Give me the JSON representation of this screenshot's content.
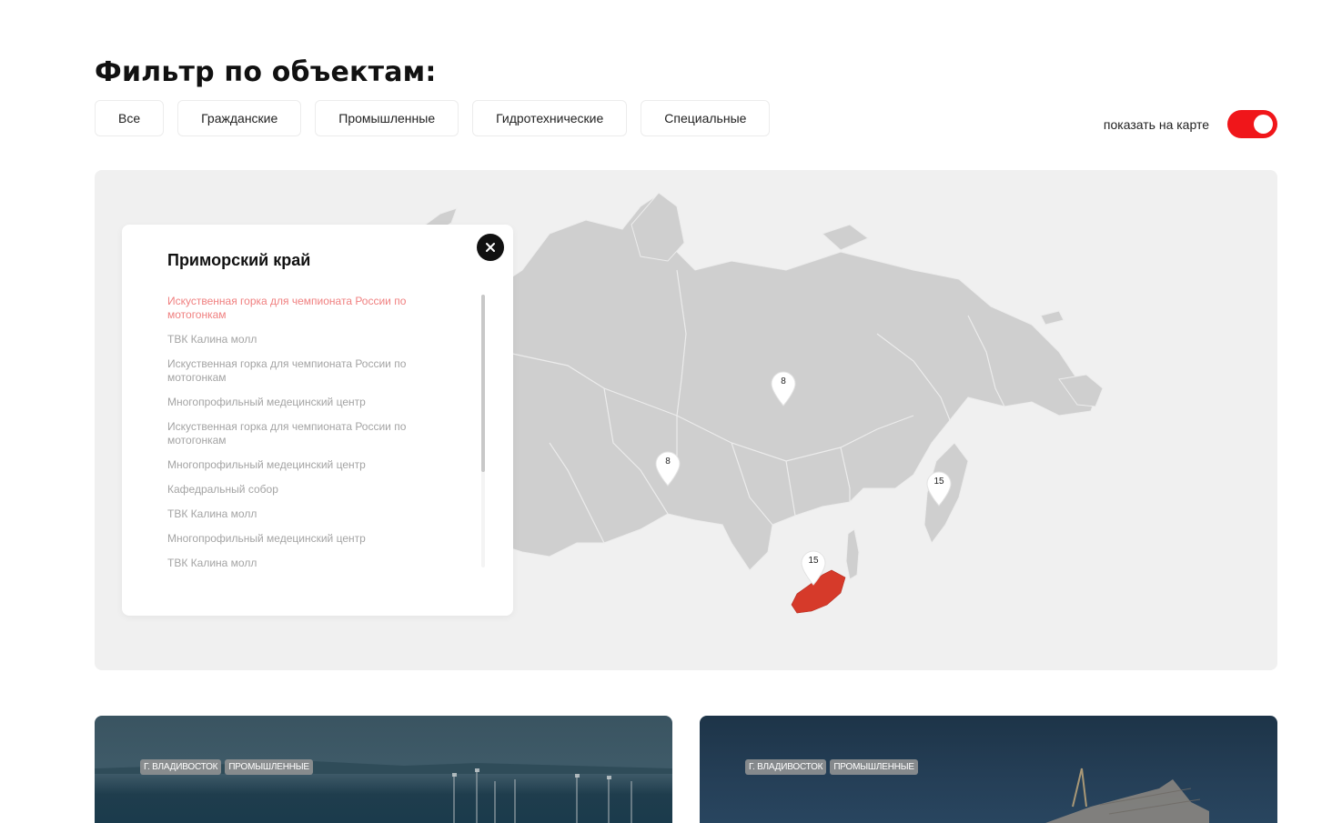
{
  "page": {
    "title": "Фильтр по объектам:"
  },
  "filters": [
    {
      "label": "Все"
    },
    {
      "label": "Гражданские"
    },
    {
      "label": "Промышленные"
    },
    {
      "label": "Гидротехнические"
    },
    {
      "label": "Специальные"
    }
  ],
  "map_toggle": {
    "label": "показать на карте",
    "on": true,
    "color": "#f0161a"
  },
  "map": {
    "highlight_color": "#d63a2a",
    "land_color": "#cfcfcf",
    "markers": [
      {
        "count": "8"
      },
      {
        "count": "8"
      },
      {
        "count": "15"
      },
      {
        "count": "15"
      }
    ]
  },
  "region_card": {
    "title": "Приморский край",
    "close_icon": "close-icon",
    "items": [
      {
        "label": "Искуственная горка для чемпионата России по мотогонкам",
        "active": true
      },
      {
        "label": "ТВК Калина молл",
        "active": false
      },
      {
        "label": "Искуственная горка для чемпионата России по мотогонкам",
        "active": false
      },
      {
        "label": "Многопрофильный медецинский центр",
        "active": false
      },
      {
        "label": "Искуственная горка для чемпионата России по мотогонкам",
        "active": false
      },
      {
        "label": "Многопрофильный медецинский центр",
        "active": false
      },
      {
        "label": "Кафедральный собор",
        "active": false
      },
      {
        "label": "ТВК Калина молл",
        "active": false
      },
      {
        "label": "Многопрофильный медецинский центр",
        "active": false
      },
      {
        "label": "ТВК Калина молл",
        "active": false
      }
    ]
  },
  "projects": [
    {
      "tags": [
        "г. владивосток",
        "промышленные"
      ]
    },
    {
      "tags": [
        "г. владивосток",
        "промышленные"
      ]
    }
  ]
}
